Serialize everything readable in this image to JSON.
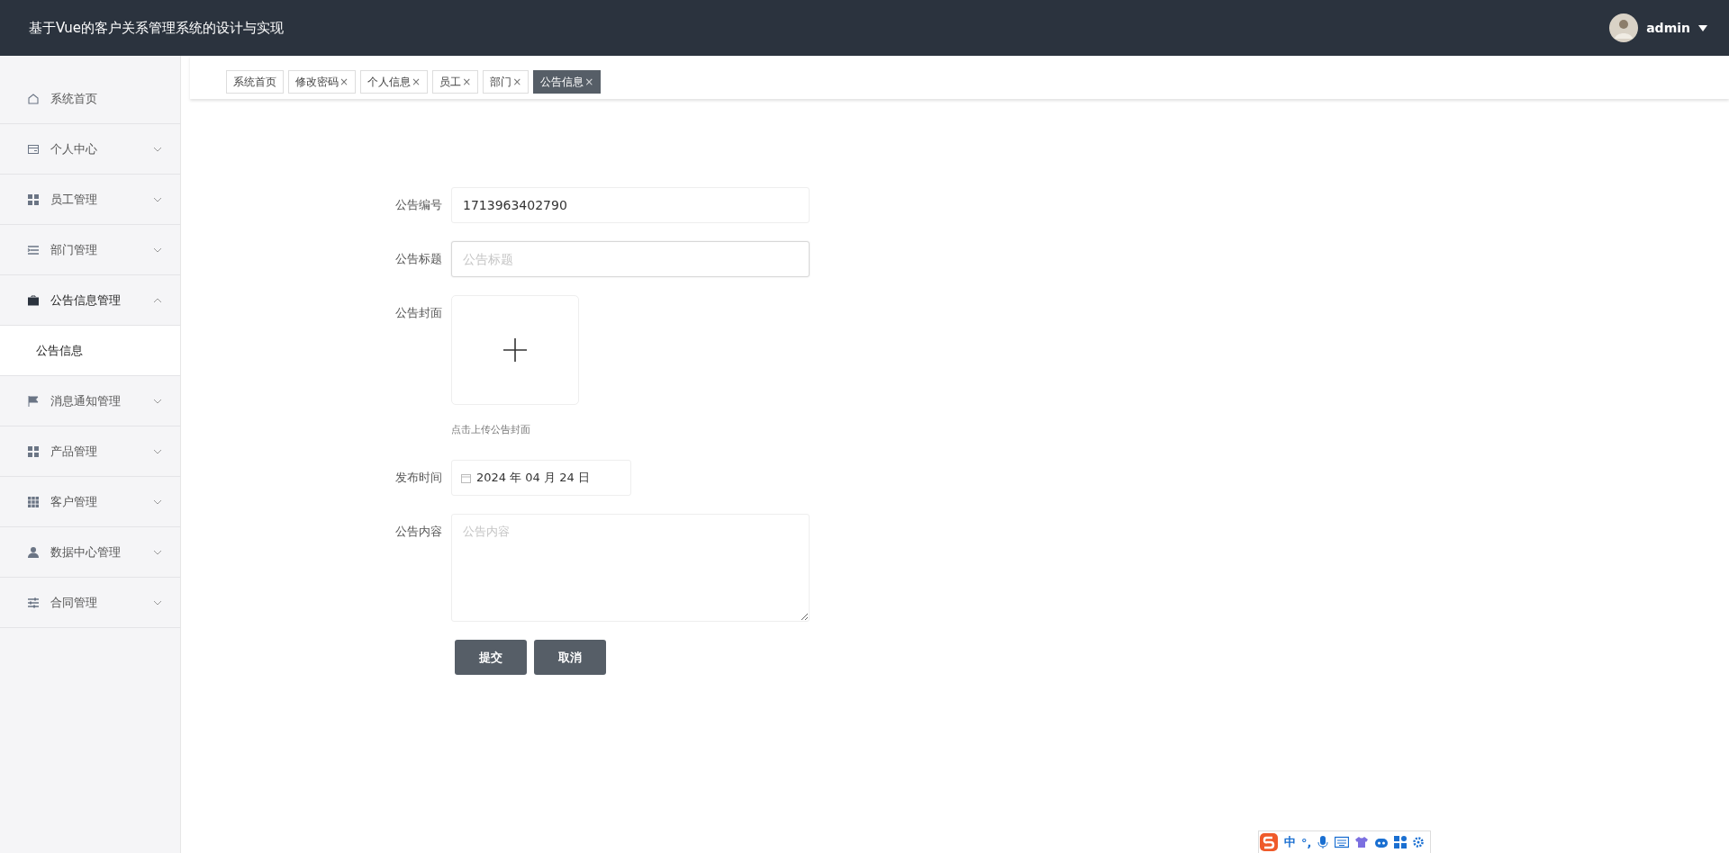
{
  "header": {
    "title": "基于Vue的客户关系管理系统的设计与实现",
    "user": "admin"
  },
  "sidebar": {
    "items": [
      {
        "label": "系统首页",
        "expandable": false,
        "expanded": false
      },
      {
        "label": "个人中心",
        "expandable": true,
        "expanded": false
      },
      {
        "label": "员工管理",
        "expandable": true,
        "expanded": false
      },
      {
        "label": "部门管理",
        "expandable": true,
        "expanded": false
      },
      {
        "label": "公告信息管理",
        "expandable": true,
        "expanded": true,
        "children": [
          {
            "label": "公告信息",
            "selected": true
          }
        ]
      },
      {
        "label": "消息通知管理",
        "expandable": true,
        "expanded": false
      },
      {
        "label": "产品管理",
        "expandable": true,
        "expanded": false
      },
      {
        "label": "客户管理",
        "expandable": true,
        "expanded": false
      },
      {
        "label": "数据中心管理",
        "expandable": true,
        "expanded": false
      },
      {
        "label": "合同管理",
        "expandable": true,
        "expanded": false
      }
    ]
  },
  "tabs": [
    {
      "label": "系统首页",
      "selected": false
    },
    {
      "label": "修改密码",
      "close": "×",
      "selected": false
    },
    {
      "label": "个人信息",
      "close": "×",
      "selected": false
    },
    {
      "label": "员工",
      "close": "×",
      "selected": false
    },
    {
      "label": "部门",
      "close": "×",
      "selected": false
    },
    {
      "label": "公告信息",
      "close": "×",
      "selected": true
    }
  ],
  "form": {
    "fields": [
      {
        "kind": "text",
        "label": "公告编号",
        "value": "1713963402790"
      },
      {
        "kind": "text",
        "label": "公告标题",
        "placeholder": "公告标题",
        "focused": true
      },
      {
        "kind": "upload",
        "label": "公告封面",
        "hint": "点击上传公告封面"
      },
      {
        "kind": "date",
        "label": "发布时间",
        "value": "2024 年 04 月 24 日"
      },
      {
        "kind": "textarea",
        "label": "公告内容",
        "placeholder": "公告内容"
      }
    ],
    "buttons": [
      "提交",
      "取消"
    ]
  },
  "ime_bar": {
    "mode": "中",
    "punctuation": "°,"
  }
}
